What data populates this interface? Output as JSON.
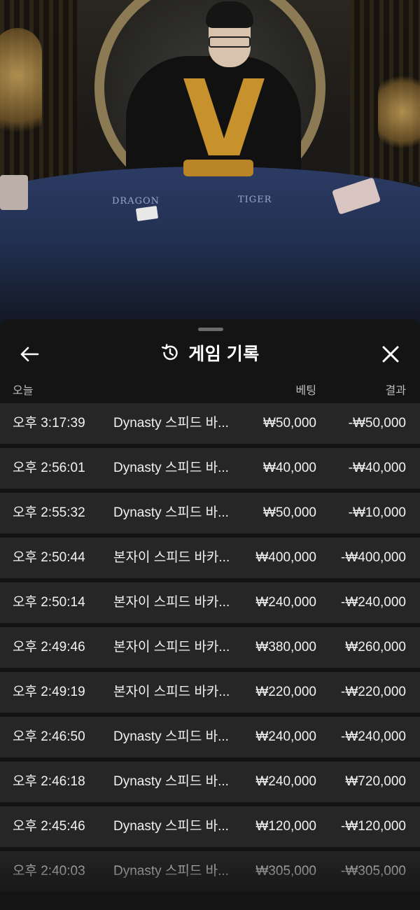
{
  "sheet": {
    "title": "게임 기록",
    "icons": {
      "back": "arrow-left-icon",
      "history": "history-icon",
      "close": "close-icon"
    }
  },
  "columns": {
    "date": "오늘",
    "bet": "베팅",
    "result": "결과"
  },
  "rows": [
    {
      "time": "오후 3:17:39",
      "game": "Dynasty 스피드 바...",
      "bet": "₩50,000",
      "result": "-₩50,000"
    },
    {
      "time": "오후 2:56:01",
      "game": "Dynasty 스피드 바...",
      "bet": "₩40,000",
      "result": "-₩40,000"
    },
    {
      "time": "오후 2:55:32",
      "game": "Dynasty 스피드 바...",
      "bet": "₩50,000",
      "result": "-₩10,000"
    },
    {
      "time": "오후 2:50:44",
      "game": "본자이 스피드 바카...",
      "bet": "₩400,000",
      "result": "-₩400,000"
    },
    {
      "time": "오후 2:50:14",
      "game": "본자이 스피드 바카...",
      "bet": "₩240,000",
      "result": "-₩240,000"
    },
    {
      "time": "오후 2:49:46",
      "game": "본자이 스피드 바카...",
      "bet": "₩380,000",
      "result": "₩260,000"
    },
    {
      "time": "오후 2:49:19",
      "game": "본자이 스피드 바카...",
      "bet": "₩220,000",
      "result": "-₩220,000"
    },
    {
      "time": "오후 2:46:50",
      "game": "Dynasty 스피드 바...",
      "bet": "₩240,000",
      "result": "-₩240,000"
    },
    {
      "time": "오후 2:46:18",
      "game": "Dynasty 스피드 바...",
      "bet": "₩240,000",
      "result": "₩720,000"
    },
    {
      "time": "오후 2:45:46",
      "game": "Dynasty 스피드 바...",
      "bet": "₩120,000",
      "result": "-₩120,000"
    },
    {
      "time": "오후 2:40:03",
      "game": "Dynasty 스피드 바...",
      "bet": "₩305,000",
      "result": "-₩305,000"
    }
  ],
  "video": {
    "table_labels": {
      "left": "DRAGON",
      "right": "TIGER"
    }
  }
}
